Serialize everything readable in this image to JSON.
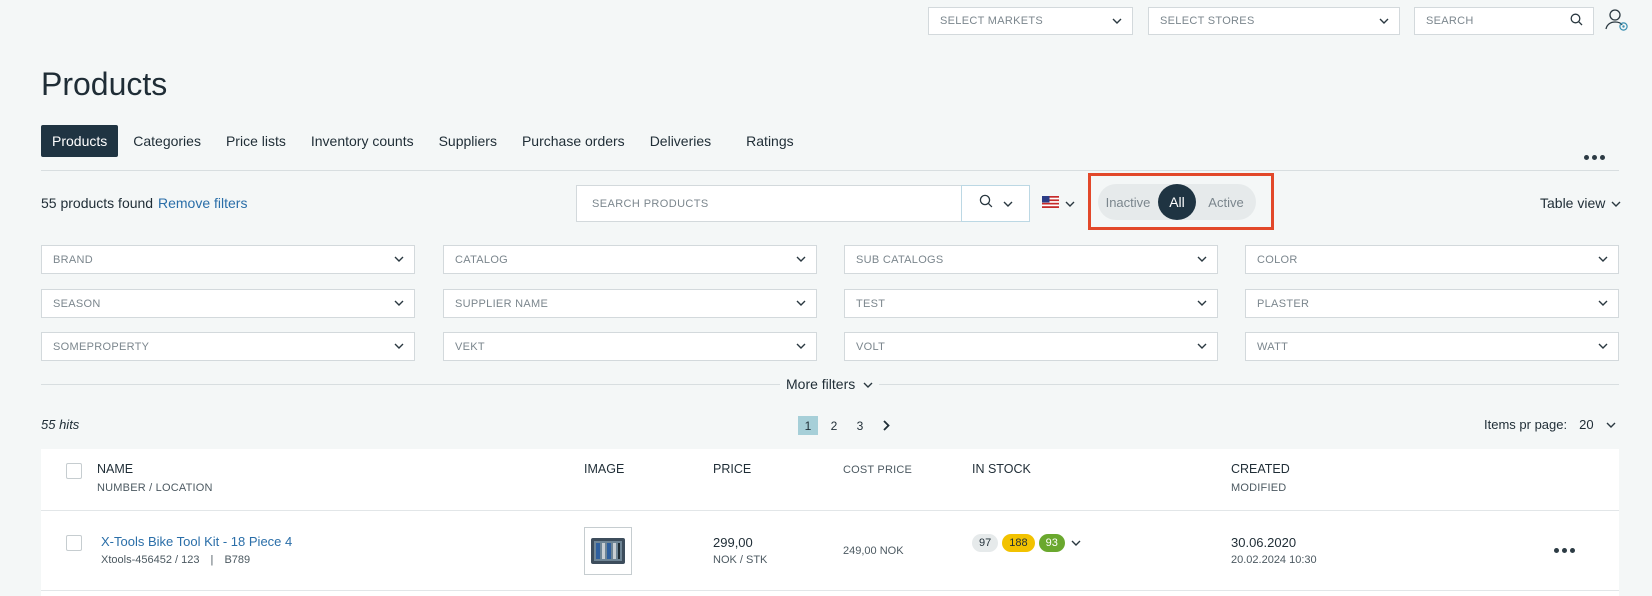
{
  "header": {
    "markets_placeholder": "SELECT MARKETS",
    "stores_placeholder": "SELECT STORES",
    "search_placeholder": "SEARCH"
  },
  "page": {
    "title": "Products"
  },
  "tabs": [
    {
      "label": "Products",
      "active": true
    },
    {
      "label": "Categories"
    },
    {
      "label": "Price lists"
    },
    {
      "label": "Inventory counts"
    },
    {
      "label": "Suppliers"
    },
    {
      "label": "Purchase orders"
    },
    {
      "label": "Deliveries"
    },
    {
      "label": "Ratings"
    }
  ],
  "toolbar": {
    "count_text": "55 products found",
    "remove_filters": "Remove filters",
    "search_placeholder": "SEARCH PRODUCTS",
    "status_inactive": "Inactive",
    "status_all": "All",
    "status_active": "Active",
    "view_label": "Table view"
  },
  "filters": [
    [
      "BRAND",
      "CATALOG",
      "SUB CATALOGS",
      "COLOR"
    ],
    [
      "SEASON",
      "SUPPLIER NAME",
      "TEST",
      "PLASTER"
    ],
    [
      "SOMEPROPERTY",
      "VEKT",
      "VOLT",
      "WATT"
    ]
  ],
  "more_filters": "More filters",
  "results": {
    "hits": "55 hits",
    "pages": [
      "1",
      "2",
      "3"
    ],
    "current_page": "1",
    "items_per_page_label": "Items pr page:",
    "items_per_page": "20"
  },
  "table": {
    "headers": {
      "name": "NAME",
      "number_location": "NUMBER / LOCATION",
      "image": "IMAGE",
      "price": "PRICE",
      "cost_price": "COST PRICE",
      "in_stock": "IN STOCK",
      "created": "CREATED",
      "modified": "MODIFIED"
    },
    "rows": [
      {
        "name": "X-Tools Bike Tool Kit - 18 Piece 4",
        "number": "Xtools-456452 / 123",
        "location": "B789",
        "price": "299,00",
        "price_unit": "NOK / STK",
        "cost_price": "249,00 NOK",
        "stock": [
          "97",
          "188",
          "93"
        ],
        "created": "30.06.2020",
        "modified": "20.02.2024 10:30"
      }
    ]
  },
  "colors": {
    "accent_dark": "#1f3442",
    "link": "#2a6ea8",
    "highlight_frame": "#e2482a",
    "badge_gray": "#e6eaeb",
    "badge_yellow": "#f2c200",
    "badge_green": "#6aa82e"
  }
}
